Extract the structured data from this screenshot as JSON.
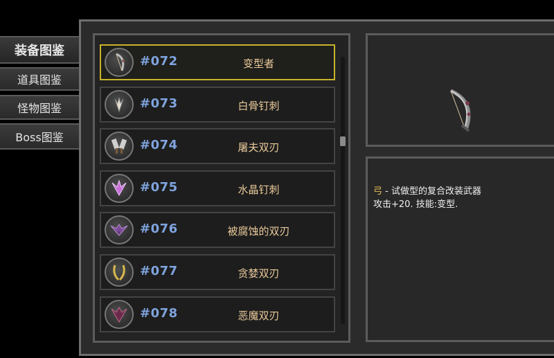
{
  "tabs": [
    {
      "label": "装备图鉴",
      "active": true
    },
    {
      "label": "道具图鉴",
      "active": false
    },
    {
      "label": "怪物图鉴",
      "active": false
    },
    {
      "label": "Boss图鉴",
      "active": false
    }
  ],
  "items": [
    {
      "number": "#072",
      "name": "变型者",
      "icon": "bow-icon",
      "selected": true
    },
    {
      "number": "#073",
      "name": "白骨钉刺",
      "icon": "bone-spike-icon",
      "selected": false
    },
    {
      "number": "#074",
      "name": "屠夫双刃",
      "icon": "butcher-blades-icon",
      "selected": false
    },
    {
      "number": "#075",
      "name": "水晶钉刺",
      "icon": "crystal-spike-icon",
      "selected": false
    },
    {
      "number": "#076",
      "name": "被腐蚀的双刃",
      "icon": "corroded-blades-icon",
      "selected": false
    },
    {
      "number": "#077",
      "name": "贪婪双刃",
      "icon": "greed-blades-icon",
      "selected": false
    },
    {
      "number": "#078",
      "name": "恶魔双刃",
      "icon": "demon-blades-icon",
      "selected": false
    }
  ],
  "detail": {
    "preview_icon": "bow-icon",
    "type_word": "弓",
    "line1_rest": " - 试做型的复合改装武器",
    "line2": "攻击+20. 技能:变型."
  },
  "colors": {
    "number": "#7fa4de",
    "name": "#e9c99a",
    "selected_border": "#c9b42a",
    "type_word": "#e8c05c"
  }
}
